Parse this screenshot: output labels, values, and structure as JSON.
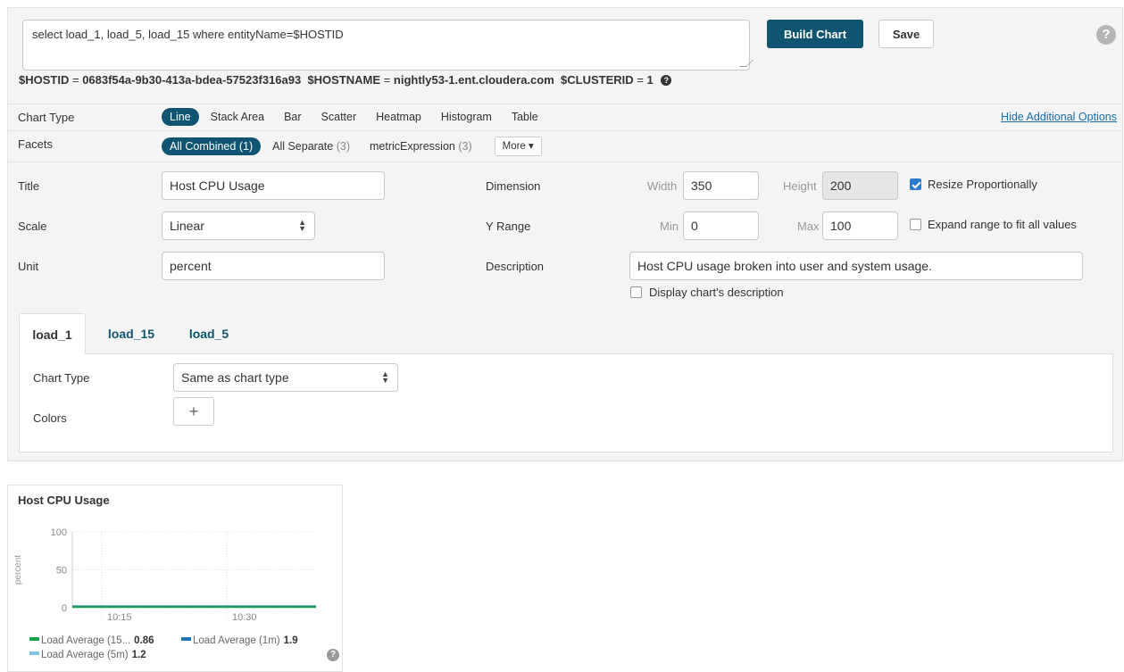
{
  "query": {
    "text": "select load_1, load_5, load_15 where entityName=$HOSTID"
  },
  "toolbar": {
    "build_label": "Build Chart",
    "save_label": "Save",
    "help_glyph": "?"
  },
  "variables": [
    {
      "name": "$HOSTID",
      "value": "0683f54a-9b30-413a-bdea-57523f316a93"
    },
    {
      "name": "$HOSTNAME",
      "value": "nightly53-1.ent.cloudera.com"
    },
    {
      "name": "$CLUSTERID",
      "value": "1"
    }
  ],
  "eq_sign": "=",
  "chart_type_row": {
    "label": "Chart Type",
    "options": [
      "Line",
      "Stack Area",
      "Bar",
      "Scatter",
      "Heatmap",
      "Histogram",
      "Table"
    ],
    "selected": "Line",
    "hide_link": "Hide Additional Options"
  },
  "facets_row": {
    "label": "Facets",
    "options": [
      {
        "label": "All Combined",
        "count": "(1)"
      },
      {
        "label": "All Separate",
        "count": "(3)"
      },
      {
        "label": "metricExpression",
        "count": "(3)"
      }
    ],
    "more_label": "More ▾"
  },
  "form": {
    "title_label": "Title",
    "title_value": "Host CPU Usage",
    "scale_label": "Scale",
    "scale_value": "Linear",
    "unit_label": "Unit",
    "unit_value": "percent",
    "dimension_label": "Dimension",
    "width_label": "Width",
    "width_value": "350",
    "height_label": "Height",
    "height_value": "200",
    "resize_label": "Resize Proportionally",
    "yrange_label": "Y Range",
    "min_label": "Min",
    "min_value": "0",
    "max_label": "Max",
    "max_value": "100",
    "expand_label": "Expand range to fit all values",
    "description_label": "Description",
    "description_value": "Host CPU usage broken into user and system usage.",
    "display_desc_label": "Display chart's description"
  },
  "series_tabs": {
    "tabs": [
      "load_1",
      "load_15",
      "load_5"
    ],
    "active": "load_1",
    "chart_type_label": "Chart Type",
    "chart_type_value": "Same as chart type",
    "colors_label": "Colors",
    "plus_glyph": "+"
  },
  "chart_card": {
    "title": "Host CPU Usage",
    "help_glyph": "?"
  },
  "chart_data": {
    "type": "line",
    "title": "Host CPU Usage",
    "ylabel": "percent",
    "ylim": [
      0,
      100
    ],
    "yticks": [
      "0",
      "50",
      "100"
    ],
    "xticks": [
      "10:15",
      "10:30"
    ],
    "grid": true,
    "series": [
      {
        "name": "Load Average (15...",
        "color": "#1aa34a",
        "current": "0.86",
        "values": [
          0.86,
          0.86,
          0.86,
          0.86,
          0.86
        ]
      },
      {
        "name": "Load Average (1m)",
        "color": "#1f77b4",
        "current": "1.9",
        "values": [
          1.9,
          1.9,
          1.9,
          1.9,
          1.9
        ]
      },
      {
        "name": "Load Average (5m)",
        "color": "#7fc4e0",
        "current": "1.2",
        "values": [
          1.2,
          1.2,
          1.2,
          1.2,
          1.2
        ]
      }
    ]
  }
}
